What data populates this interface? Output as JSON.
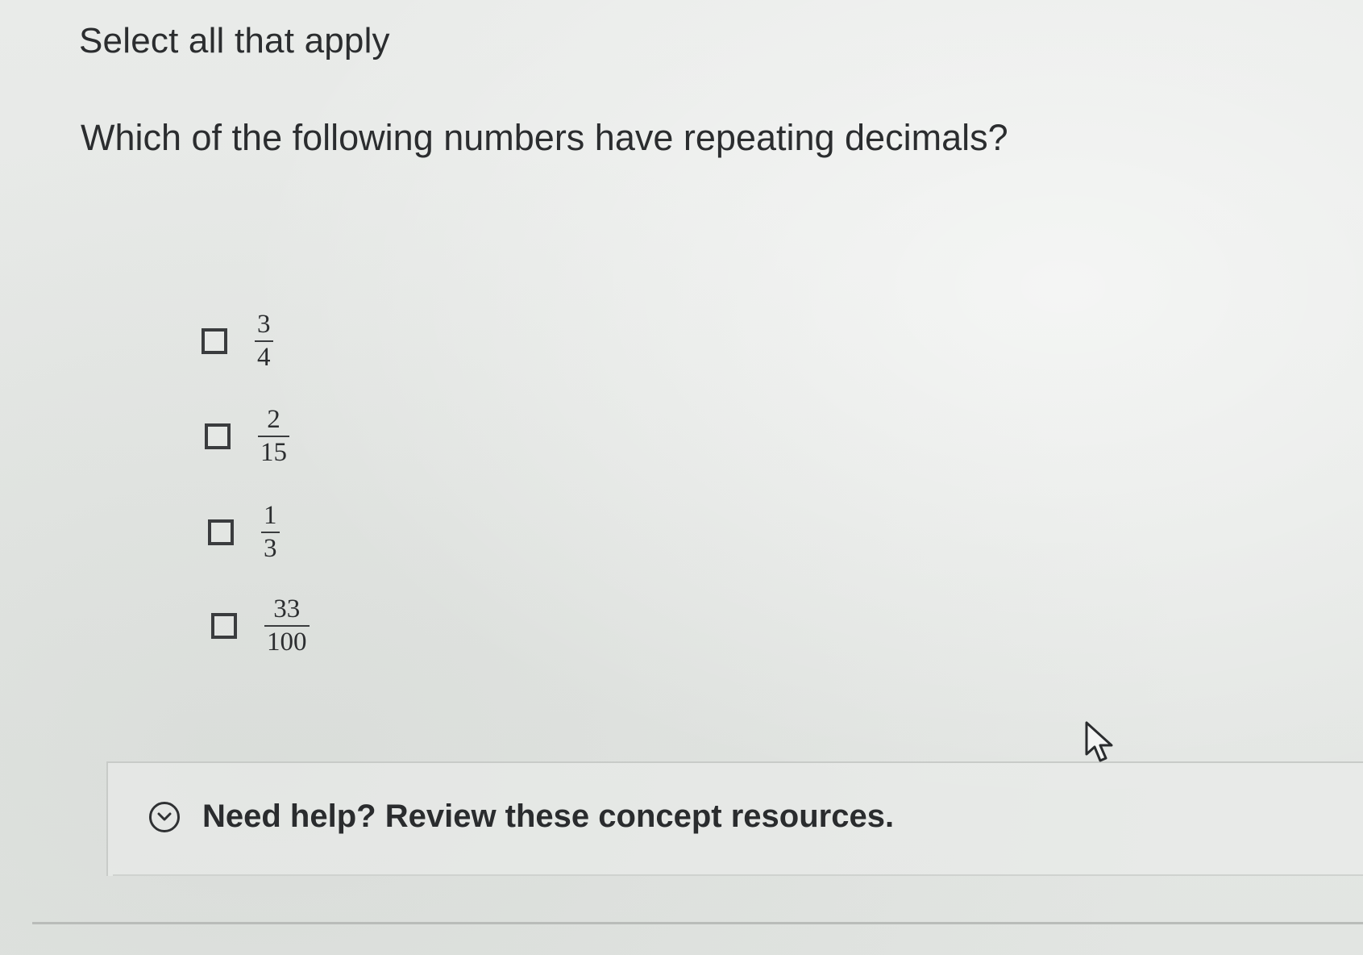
{
  "instruction": "Select all that apply",
  "question": "Which of the following numbers have repeating decimals?",
  "options": [
    {
      "numerator": "3",
      "denominator": "4",
      "checked": false
    },
    {
      "numerator": "2",
      "denominator": "15",
      "checked": false
    },
    {
      "numerator": "1",
      "denominator": "3",
      "checked": false
    },
    {
      "numerator": "33",
      "denominator": "100",
      "checked": false
    }
  ],
  "help": {
    "label": "Need help? Review these concept resources.",
    "icon": "chevron-down-circle-icon"
  },
  "cursor_icon": "mouse-pointer-icon"
}
